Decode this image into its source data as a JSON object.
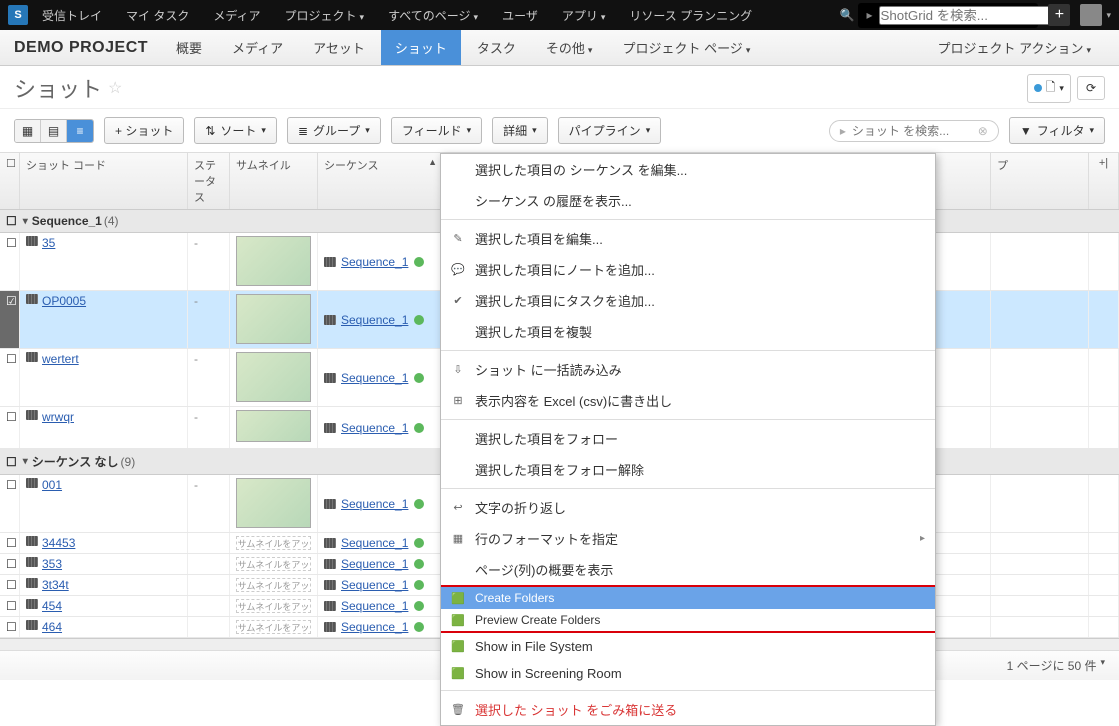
{
  "topbar": {
    "items": [
      "受信トレイ",
      "マイ タスク",
      "メディア",
      "プロジェクト",
      "すべてのページ",
      "ユーザ",
      "アプリ",
      "リソース プランニング"
    ],
    "dropdown_flags": [
      false,
      false,
      false,
      true,
      true,
      false,
      true,
      false
    ],
    "search_placeholder": "ShotGrid を検索..."
  },
  "project": {
    "title": "DEMO PROJECT",
    "tabs": [
      "概要",
      "メディア",
      "アセット",
      "ショット",
      "タスク",
      "その他",
      "プロジェクト ページ"
    ],
    "tab_dropdown": [
      false,
      false,
      false,
      false,
      false,
      true,
      true
    ],
    "active_tab": 3,
    "actions_label": "プロジェクト アクション"
  },
  "page": {
    "title": "ショット"
  },
  "toolbar": {
    "add_shot": "+ ショット",
    "sort": "ソート",
    "group": "グループ",
    "fields": "フィールド",
    "detail": "詳細",
    "pipeline": "パイプライン",
    "filter": "フィルタ",
    "search_placeholder": "ショット を検索..."
  },
  "grid": {
    "headers": {
      "code": "ショット コード",
      "status": "ステータス",
      "thumb": "サムネイル",
      "seq": "シーケンス",
      "extra": "プ",
      "add": "+|"
    },
    "group1": {
      "name": "Sequence_1",
      "count": "(4)"
    },
    "group2": {
      "name": "シーケンス なし",
      "count": "(9)"
    },
    "thumb_upload_text": "サムネイルをアッ",
    "seq_link": "Sequence_1",
    "rows_g1": [
      {
        "code": "35"
      },
      {
        "code": "OP0005",
        "selected": true
      },
      {
        "code": "wertert"
      },
      {
        "code": "wrwqr"
      }
    ],
    "rows_g2": [
      {
        "code": "001",
        "tall": true
      },
      {
        "code": "34453"
      },
      {
        "code": "353"
      },
      {
        "code": "3t34t"
      },
      {
        "code": "454"
      },
      {
        "code": "464"
      }
    ]
  },
  "ctx": {
    "edit_seq": "選択した項目の シーケンス を編集...",
    "history_seq": "シーケンス の履歴を表示...",
    "edit_sel": "選択した項目を編集...",
    "note_sel": "選択した項目にノートを追加...",
    "task_sel": "選択した項目にタスクを追加...",
    "dup_sel": "選択した項目を複製",
    "bulk_import": "ショット に一括読み込み",
    "export_csv": "表示内容を Excel (csv)に書き出し",
    "follow": "選択した項目をフォロー",
    "unfollow": "選択した項目をフォロー解除",
    "wrap": "文字の折り返し",
    "fmt": "行のフォーマットを指定",
    "summary": "ページ(列)の概要を表示",
    "create_folders": "Create Folders",
    "preview_folders": "Preview Create Folders",
    "show_fs": "Show in File System",
    "show_sr": "Show in Screening Room",
    "trash": "選択した ショット をごみ箱に送る"
  },
  "footer": {
    "pager": "1 ページに 50 件"
  }
}
